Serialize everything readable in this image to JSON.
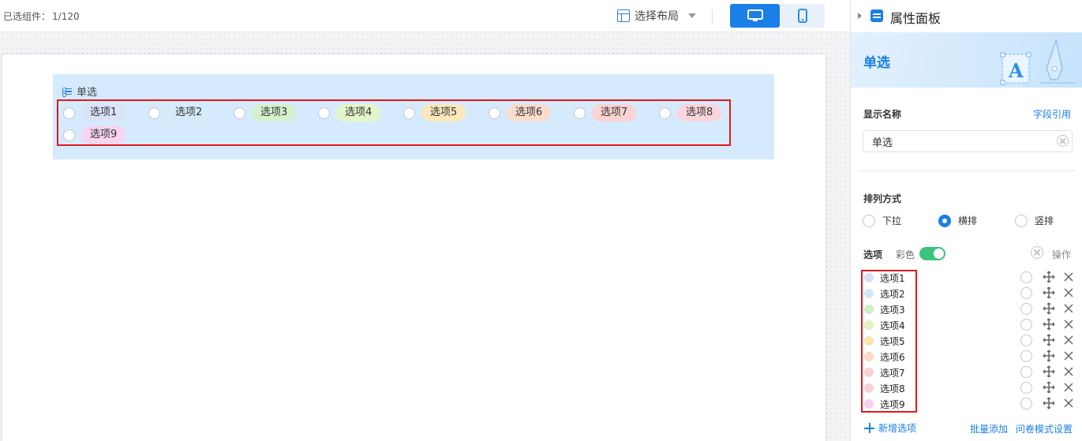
{
  "toolbar": {
    "selected_label": "已选组件：",
    "selected_count": "1/120",
    "layout_label": "选择布局",
    "device_pc_icon": "desktop-icon",
    "device_mobile_icon": "mobile-icon"
  },
  "widget": {
    "title": "单选",
    "title_icon": "radio-list-icon",
    "options": [
      {
        "label": "选项1",
        "color": "#dbe3fb"
      },
      {
        "label": "选项2",
        "color": "#d4ecfb"
      },
      {
        "label": "选项3",
        "color": "#d3f1cd"
      },
      {
        "label": "选项4",
        "color": "#e4f5c9"
      },
      {
        "label": "选项5",
        "color": "#fbe9bd"
      },
      {
        "label": "选项6",
        "color": "#fbdccf"
      },
      {
        "label": "选项7",
        "color": "#fbd3d3"
      },
      {
        "label": "选项8",
        "color": "#fbd4dd"
      },
      {
        "label": "选项9",
        "color": "#f8d4f0"
      }
    ]
  },
  "panel": {
    "title": "属性面板",
    "banner_title": "单选",
    "display_name_label": "显示名称",
    "field_ref_link": "字段引用",
    "display_name_value": "单选",
    "arrangement_label": "排列方式",
    "arrangement_options": [
      "下拉",
      "横排",
      "竖排"
    ],
    "arrangement_selected": "横排",
    "options_label": "选项",
    "colorful_label": "彩色",
    "colorful_enabled": true,
    "ops_label": "操作",
    "option_list": [
      {
        "label": "选项1",
        "color": "#d7dff9"
      },
      {
        "label": "选项2",
        "color": "#cfe9fa"
      },
      {
        "label": "选项3",
        "color": "#cdeec6"
      },
      {
        "label": "选项4",
        "color": "#e0f3c2"
      },
      {
        "label": "选项5",
        "color": "#f9e5b4"
      },
      {
        "label": "选项6",
        "color": "#f9d8ca"
      },
      {
        "label": "选项7",
        "color": "#f9cfcf"
      },
      {
        "label": "选项8",
        "color": "#f9d0da"
      },
      {
        "label": "选项9",
        "color": "#f5d0ee"
      }
    ],
    "add_option": "新增选项",
    "batch_add": "批量添加",
    "survey_mode": "问卷模式设置"
  },
  "colors": {
    "accent": "#1a7fe8",
    "highlight_border": "#e0191f",
    "widget_bg": "#d5ebfd",
    "toggle_on": "#3cc47c"
  }
}
